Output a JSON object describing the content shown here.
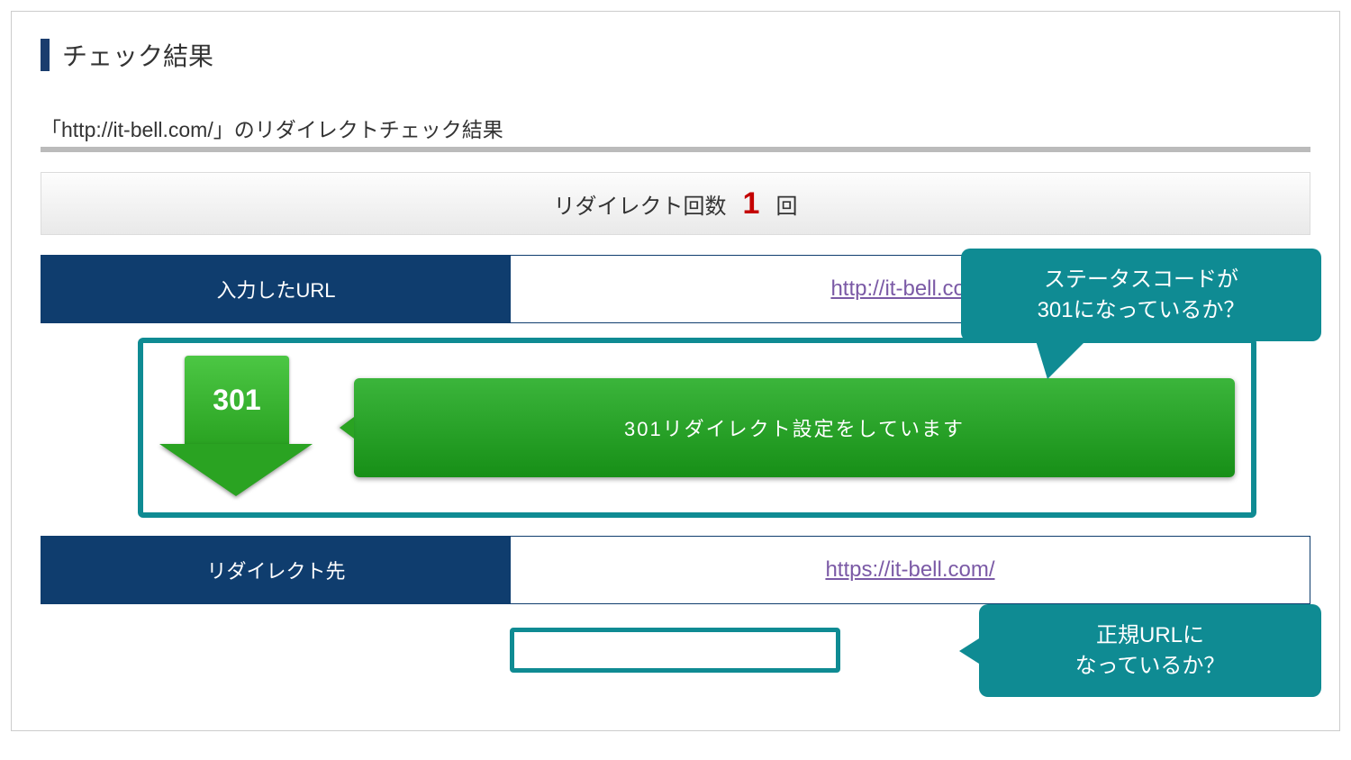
{
  "title": "チェック結果",
  "subtitle": "「http://it-bell.com/」のリダイレクトチェック結果",
  "redirect_count_label": "リダイレクト回数",
  "redirect_count_value": "1",
  "redirect_count_unit": " 回",
  "row_input": {
    "label": "入力したURL",
    "url": "http://it-bell.com/"
  },
  "status": {
    "code": "301",
    "message": "301リダイレクト設定をしています"
  },
  "row_dest": {
    "label": "リダイレクト先",
    "url": "https://it-bell.com/"
  },
  "bubble1": "ステータスコードが\n301になっているか？",
  "bubble2": "正規URLに\nなっているか？"
}
